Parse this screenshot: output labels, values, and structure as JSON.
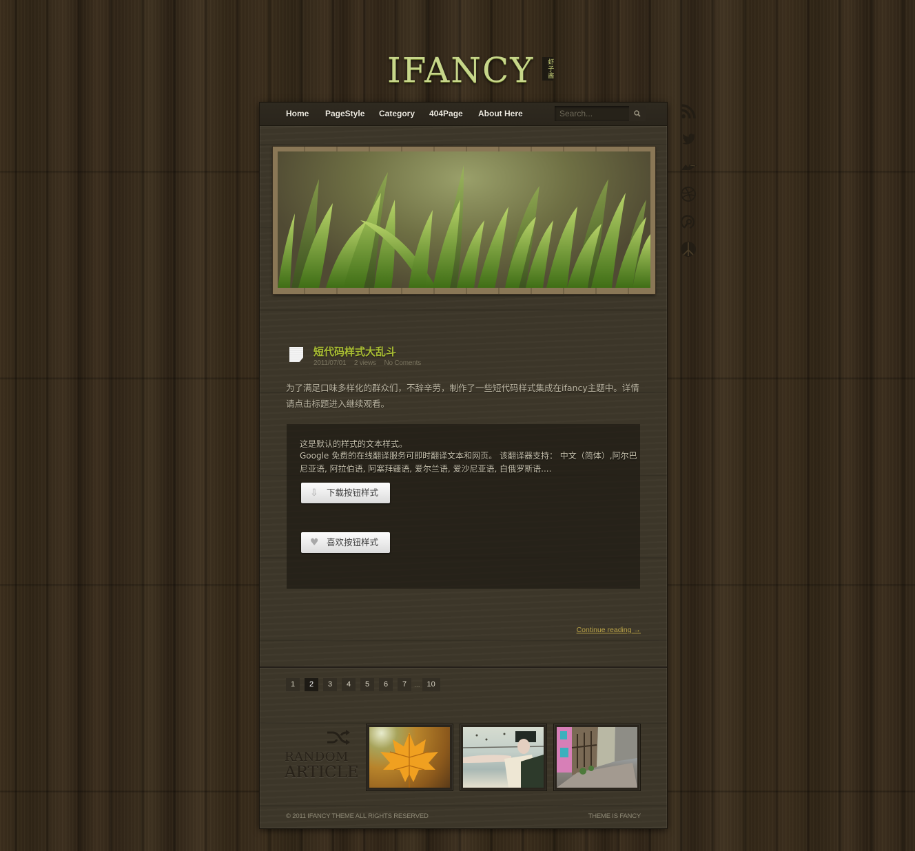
{
  "logo": {
    "title": "IFANCY",
    "tagline": "虾子酱"
  },
  "nav": {
    "items": [
      {
        "label": "Home"
      },
      {
        "label": "PageStyle"
      },
      {
        "label": "Category"
      },
      {
        "label": "404Page"
      },
      {
        "label": "About Here"
      }
    ],
    "search_placeholder": "Search...",
    "search_icon": "search-icon"
  },
  "social": [
    {
      "name": "rss"
    },
    {
      "name": "twitter"
    },
    {
      "name": "delicious"
    },
    {
      "name": "dribbble"
    },
    {
      "name": "reddit"
    },
    {
      "name": "peace"
    }
  ],
  "post": {
    "title": "短代码样式大乱斗",
    "date": "2011/07/01",
    "views": "2 views",
    "comments": "No Coments",
    "excerpt": "为了满足口味多样化的群众们，不辞辛劳，制作了一些短代码样式集成在ifancy主题中。详情请点击标题进入继续观看。",
    "shortcode": {
      "line1": "这是默认的样式的文本样式。",
      "line2": "Google 免费的在线翻译服务可即时翻译文本和网页。 该翻译器支持： 中文（简体）,阿尔巴尼亚语, 阿拉伯语, 阿塞拜疆语, 爱尔兰语, 爱沙尼亚语, 白俄罗斯语....",
      "download_button": "下载按钮样式",
      "like_button": "喜欢按钮样式"
    },
    "continue_reading": "Continue reading →"
  },
  "pagination": {
    "pages": [
      "1",
      "2",
      "3",
      "4",
      "5",
      "6",
      "7"
    ],
    "current": "2",
    "ellipsis": "...",
    "last": "10"
  },
  "random_article": {
    "line1": "RANDOM",
    "line2": "ARTICLE",
    "thumbnails": [
      {
        "subject": "autumn maple leaf"
      },
      {
        "subject": "warrior woman with birds"
      },
      {
        "subject": "old town street"
      }
    ]
  },
  "footer": {
    "left": "© 2011  IFANCY THEME  ALL RIGHTS RESERVED",
    "right": "THEME IS FANCY"
  }
}
